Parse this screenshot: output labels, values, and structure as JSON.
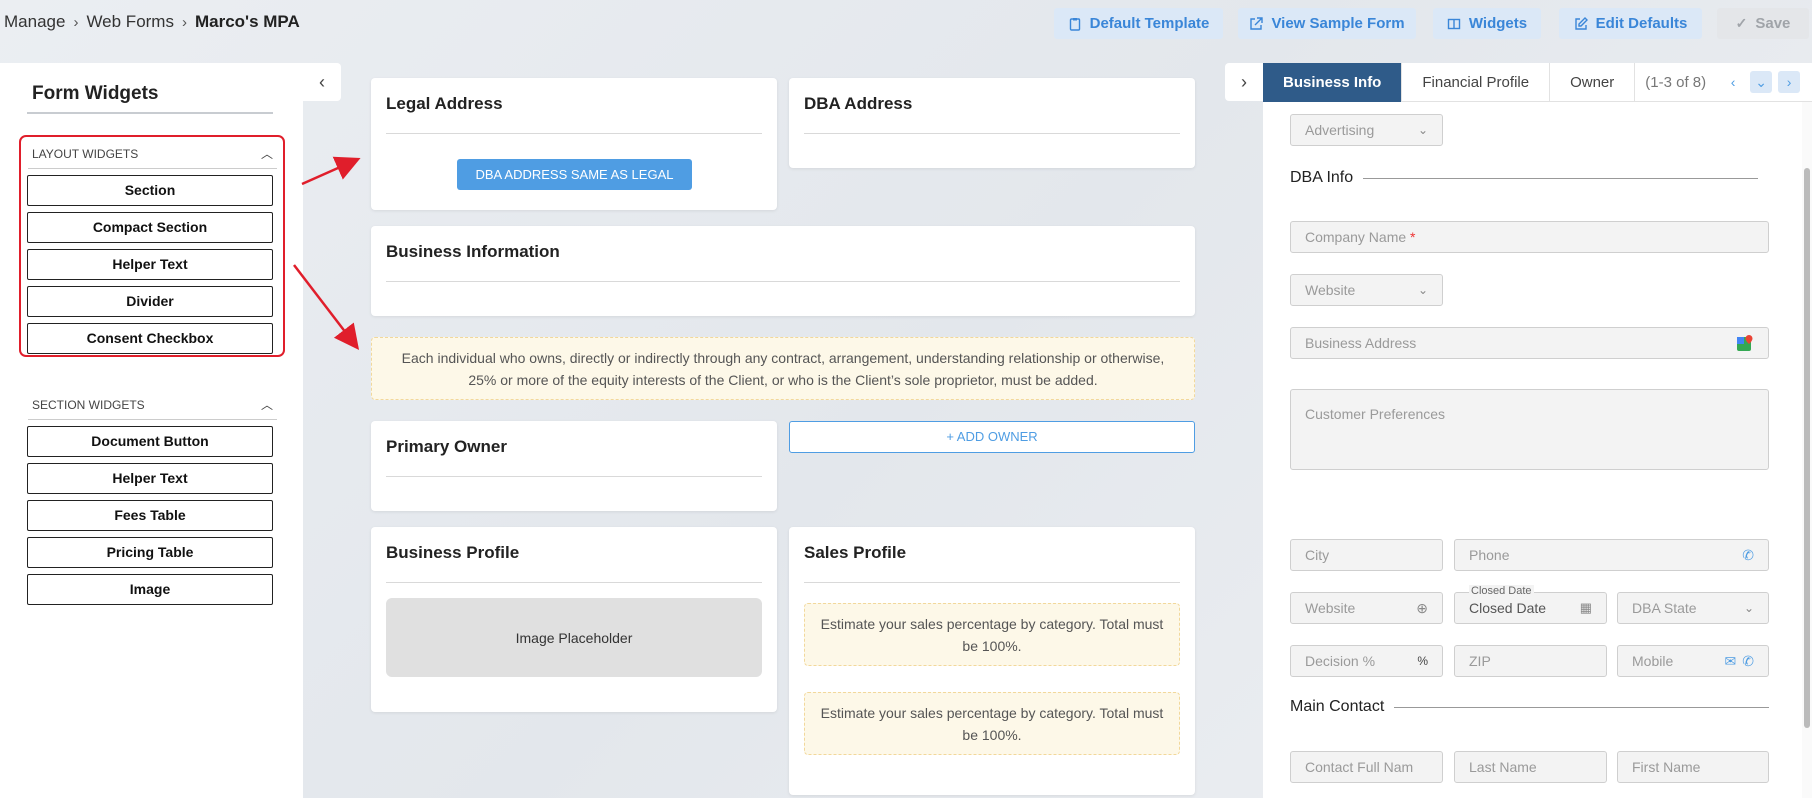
{
  "breadcrumb": {
    "items": [
      "Manage",
      "Web Forms",
      "Marco's MPA"
    ]
  },
  "toolbar": {
    "default_template": "Default Template",
    "view_sample": "View Sample Form",
    "widgets": "Widgets",
    "edit_defaults": "Edit Defaults",
    "save": "Save"
  },
  "left_panel": {
    "title": "Form Widgets",
    "layout_group": {
      "label": "LAYOUT WIDGETS",
      "items": [
        "Section",
        "Compact Section",
        "Helper Text",
        "Divider",
        "Consent Checkbox"
      ]
    },
    "section_group": {
      "label": "SECTION WIDGETS",
      "items": [
        "Document Button",
        "Helper Text",
        "Fees Table",
        "Pricing Table",
        "Image"
      ]
    }
  },
  "canvas": {
    "legal_address": {
      "title": "Legal Address",
      "button": "DBA ADDRESS SAME AS LEGAL"
    },
    "dba_address": {
      "title": "DBA Address"
    },
    "business_information": {
      "title": "Business Information"
    },
    "owner_note": "Each individual who owns, directly or indirectly through any contract, arrangement, understanding relationship or otherwise, 25% or more of the equity interests of the Client, or who is the Client’s sole proprietor, must be added.",
    "primary_owner": {
      "title": "Primary Owner"
    },
    "add_owner": "+ ADD OWNER",
    "business_profile": {
      "title": "Business Profile",
      "image_placeholder": "Image Placeholder"
    },
    "sales_profile": {
      "title": "Sales Profile",
      "note1": "Estimate your sales percentage by category. Total must be 100%.",
      "note2": "Estimate your sales percentage by category. Total must be 100%."
    }
  },
  "right_panel": {
    "tabs": [
      "Business Info",
      "Financial Profile",
      "Owner"
    ],
    "pagination": "(1-3 of 8)",
    "fields": {
      "advertising": "Advertising",
      "dba_info": "DBA Info",
      "company_name": "Company Name",
      "required_mark": "*",
      "website": "Website",
      "business_address": "Business Address",
      "customer_preferences": "Customer Preferences",
      "city": "City",
      "phone": "Phone",
      "website2": "Website",
      "closed_date_label": "Closed Date",
      "closed_date": "Closed Date",
      "dba_state": "DBA State",
      "decision": "Decision %",
      "zip": "ZIP",
      "mobile": "Mobile",
      "main_contact": "Main Contact",
      "contact_full_name": "Contact Full Nam",
      "last_name": "Last Name",
      "first_name": "First Name"
    }
  }
}
